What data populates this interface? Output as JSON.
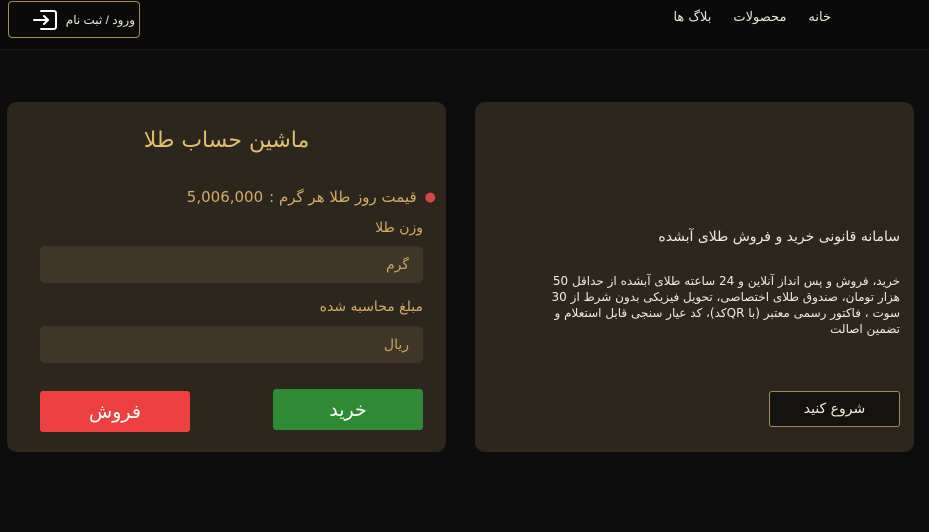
{
  "header": {
    "nav": {
      "home": "خانه",
      "products": "محصولات",
      "blogs": "بلاگ ها"
    },
    "login_label": "ورود / ثبت نام",
    "login_icon": "login-icon"
  },
  "calculator": {
    "title": "ماشین حساب طلا",
    "price_label": "قیمت روز طلا هر گرم :",
    "price_value": "5,006,000",
    "weight_label": "وزن طلا",
    "weight_placeholder": "گرم",
    "amount_label": "مبلغ محاسبه شده",
    "amount_placeholder": "ریال",
    "buy_label": "خرید",
    "sell_label": "فروش"
  },
  "info": {
    "title": "سامانه قانونی خرید و فروش طلای آبشده",
    "description": "خرید، فروش و پس انداز آنلاین و 24 ساعته طلای آبشده از حداقل 50 هزار تومان، صندوق طلای اختصاصی، تحویل فیزیکی بدون شرط از 30 سوت ، فاکتور رسمی معتبر (با QRکد)، کد عیار سنجی قابل استعلام و تضمین اصالت",
    "start_label": "شروع کنید"
  },
  "colors": {
    "background": "#0d0d0d",
    "card": "#2c261d",
    "gold": "#d4ac64",
    "buy": "#2f8a36",
    "sell": "#ee4040",
    "border": "#a48a55"
  }
}
